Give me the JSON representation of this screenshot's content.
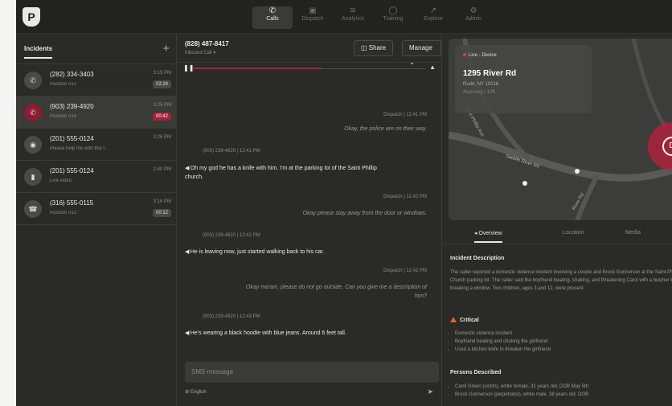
{
  "colors": {
    "accent": "#a0233d",
    "bg": "#262624",
    "critical": "#e6622e"
  },
  "nav": {
    "tabs": [
      {
        "label": "Calls",
        "icon": "phone-icon",
        "active": true
      },
      {
        "label": "Dispatch",
        "icon": "dispatch-icon"
      },
      {
        "label": "Analytics",
        "icon": "chart-icon"
      },
      {
        "label": "Training",
        "icon": "training-icon"
      },
      {
        "label": "Explore",
        "icon": "explore-icon"
      },
      {
        "label": "Admin",
        "icon": "gear-icon"
      }
    ]
  },
  "incidents": {
    "title": "Incidents",
    "items": [
      {
        "phone": "(282) 334-3403",
        "sub": "Position #12",
        "time": "3:15 PM",
        "badge": "02:24",
        "icon": "phone-icon"
      },
      {
        "phone": "(903) 239-4920",
        "sub": "Position #14",
        "time": "3:25 PM",
        "badge": "00:42",
        "icon": "phone-icon",
        "selected": true
      },
      {
        "phone": "(201) 555-0124",
        "sub": "Please help me with this f...",
        "time": "3:26 PM",
        "badge": "",
        "icon": "chat-icon"
      },
      {
        "phone": "(201) 555-0124",
        "sub": "Live video",
        "time": "2:40 PM",
        "badge": "",
        "icon": "video-icon"
      },
      {
        "phone": "(316) 555-0115",
        "sub": "Position #12",
        "time": "3:16 PM",
        "badge": "00:12",
        "icon": "phone-hangup-icon"
      }
    ]
  },
  "call": {
    "number": "(828) 487-8417",
    "direction": "Inbound Call ▾",
    "share_label": "Share",
    "manage_label": "Manage",
    "progress": 0.55
  },
  "transcript": [
    {
      "who": "dispatch",
      "meta": "Dispatch | 12:41 PM",
      "text": "Okay, the police are on their way."
    },
    {
      "who": "caller",
      "meta": "(903) 239-4920 | 12:41 PM",
      "text": "Oh my god he has a knife with him. I'm at the parking lot of the Saint Phillip church."
    },
    {
      "who": "dispatch",
      "meta": "Dispatch | 12:42 PM",
      "text": "Okay please stay away from the door or windows."
    },
    {
      "who": "caller",
      "meta": "(903) 239-4920 | 12:42 PM",
      "text": "He is leaving now, just started walking back to his car."
    },
    {
      "who": "dispatch",
      "meta": "Dispatch | 12:42 PM",
      "text": "Okay ma'am, please do not go outside. Can you give me a description of him?"
    },
    {
      "who": "caller",
      "meta": "(903) 239-4920 | 12:43 PM",
      "text": "He's wearing a black hoodie with blue jeans. Around 6 feet tall."
    }
  ],
  "sms": {
    "placeholder": "SMS message",
    "language": "English"
  },
  "map": {
    "live_label": "Live - Device",
    "address": "1295 River Rd",
    "city": "Rudd, NY 10016",
    "accuracy": "Accuracy / 12ft",
    "pin_label": "D",
    "streets": [
      "Saint Phillip Ave",
      "Saddle River Rd",
      "River Rd"
    ]
  },
  "detail_tabs": [
    "Overview",
    "Location",
    "Media"
  ],
  "overview": {
    "desc_title": "Incident Description",
    "desc": "The caller reported a domestic violence incident involving a couple and Brock Gunnerson at the Saint Phillip Church parking lot. The caller said the boyfriend beating, shaking, and threatening Carol with a butcher knife, breaking a window. Two children, ages 3 and 12, were present.",
    "critical_label": "Critical",
    "critical_items": [
      "Domestic violence incident",
      "Boyfriend beating and choking the girlfriend",
      "Used a kitchen knife to threaten the girlfriend"
    ],
    "persons_title": "Persons Described",
    "persons": [
      "Carol Green (victim), white female, 31 years old, DOB May 5th",
      "Brock Gunnerson (perpetrator), white male, 38 years old, DOB"
    ]
  }
}
